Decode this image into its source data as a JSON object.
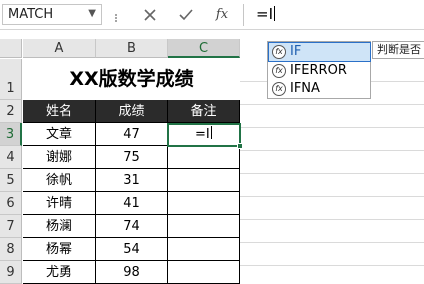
{
  "formula_bar": {
    "name_box": "MATCH",
    "cancel_icon": "close-icon",
    "enter_icon": "check-icon",
    "fx_label": "fx",
    "formula_text": "=I"
  },
  "columns": [
    "A",
    "B",
    "C"
  ],
  "rows": [
    "1",
    "2",
    "3",
    "4",
    "5",
    "6",
    "7",
    "8",
    "9"
  ],
  "sheet": {
    "title": "XX版数学成绩",
    "headers": [
      "姓名",
      "成绩",
      "备注"
    ],
    "records": [
      {
        "name": "文章",
        "score": "47"
      },
      {
        "name": "谢娜",
        "score": "75"
      },
      {
        "name": "徐帆",
        "score": "31"
      },
      {
        "name": "许晴",
        "score": "41"
      },
      {
        "name": "杨澜",
        "score": "74"
      },
      {
        "name": "杨幂",
        "score": "54"
      },
      {
        "name": "尤勇",
        "score": "98"
      }
    ],
    "active_cell_text": "=I"
  },
  "autocomplete": {
    "items": [
      "IF",
      "IFERROR",
      "IFNA"
    ],
    "selected": "IF",
    "tooltip": "判断是否"
  },
  "colors": {
    "accent": "#217346",
    "header_fill": "#2b2b2b",
    "selection": "#cfe4f7"
  }
}
